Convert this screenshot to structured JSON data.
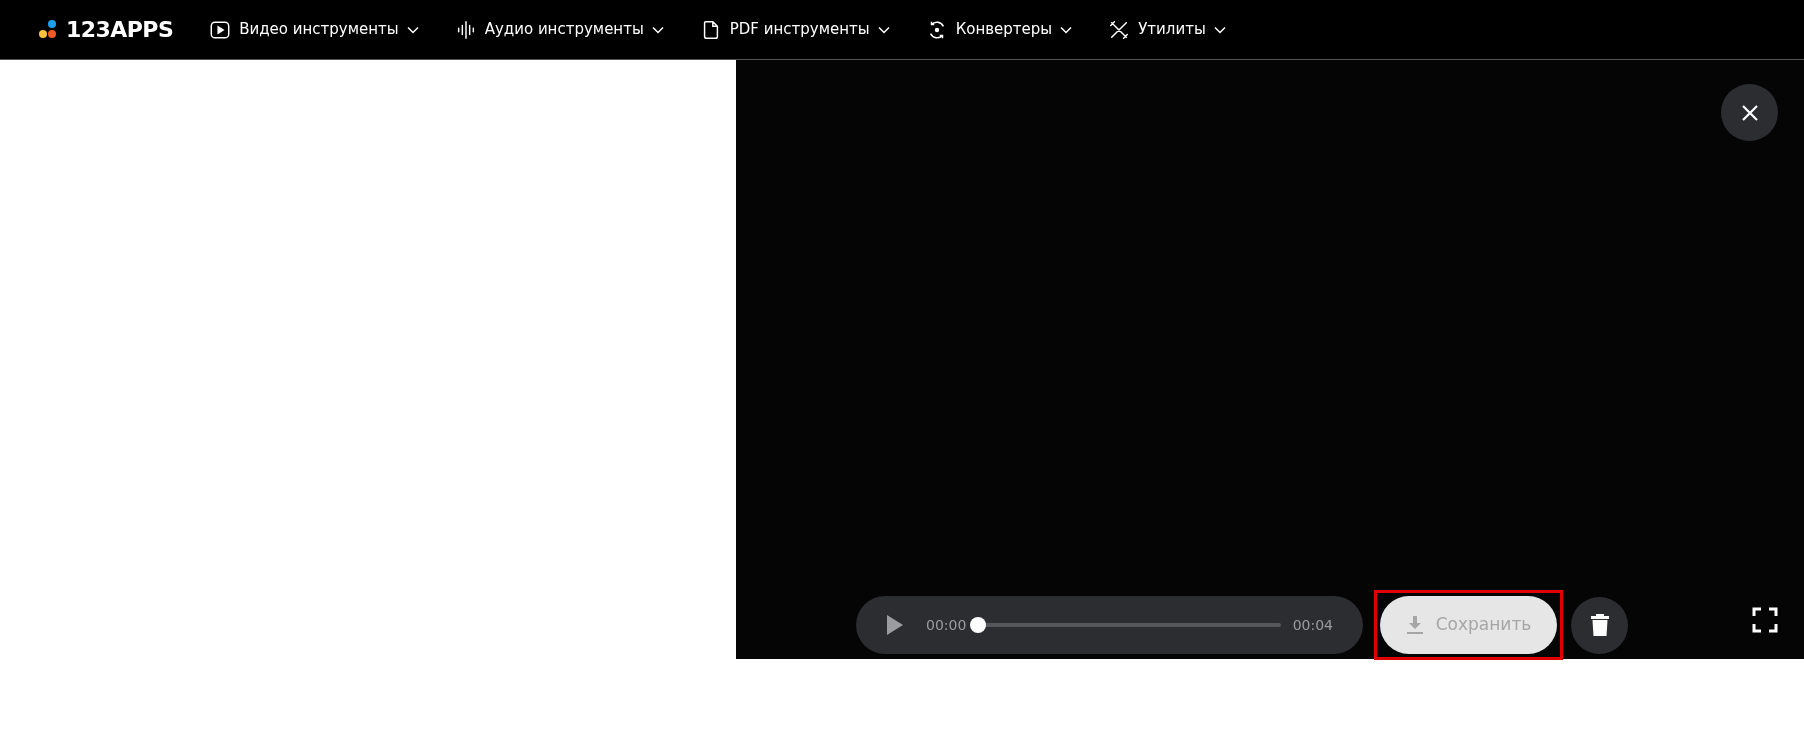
{
  "header": {
    "logo": "123APPS",
    "nav": [
      {
        "label": "Видео инструменты",
        "kind": "video"
      },
      {
        "label": "Аудио инструменты",
        "kind": "audio"
      },
      {
        "label": "PDF инструменты",
        "kind": "pdf"
      },
      {
        "label": "Конвертеры",
        "kind": "convert"
      },
      {
        "label": "Утилиты",
        "kind": "tools"
      }
    ]
  },
  "player": {
    "current_time": "00:00",
    "duration": "00:04",
    "level": 0,
    "save_button": {
      "label": "Сохранить",
      "disabled": true,
      "highlighted": true
    }
  }
}
